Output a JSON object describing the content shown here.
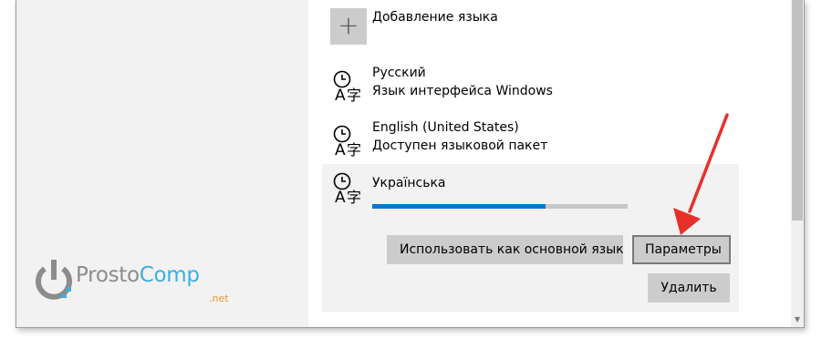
{
  "languages": {
    "add_label": "Добавление языка",
    "items": [
      {
        "name": "Русский",
        "subtitle": "Язык интерфейса Windows"
      },
      {
        "name": "English (United States)",
        "subtitle": "Доступен языковой пакет"
      }
    ],
    "selected": {
      "name": "Українська",
      "progress_percent": 68,
      "set_default_label": "Использовать как основной язык",
      "options_label": "Параметры",
      "remove_label": "Удалить"
    }
  },
  "watermark": {
    "brand_prosto": "Prosto",
    "brand_comp": "Comp",
    "suffix": ".net"
  },
  "colors": {
    "accent": "#0078d7",
    "annotation_arrow": "#e8302a",
    "logo_grey": "#8c8c8c",
    "logo_blue": "#3ab0e2",
    "logo_orange": "#f0932b"
  },
  "icons": {
    "add": "plus-icon",
    "language": "language-time-icon",
    "annotation": "red-arrow-annotation"
  }
}
